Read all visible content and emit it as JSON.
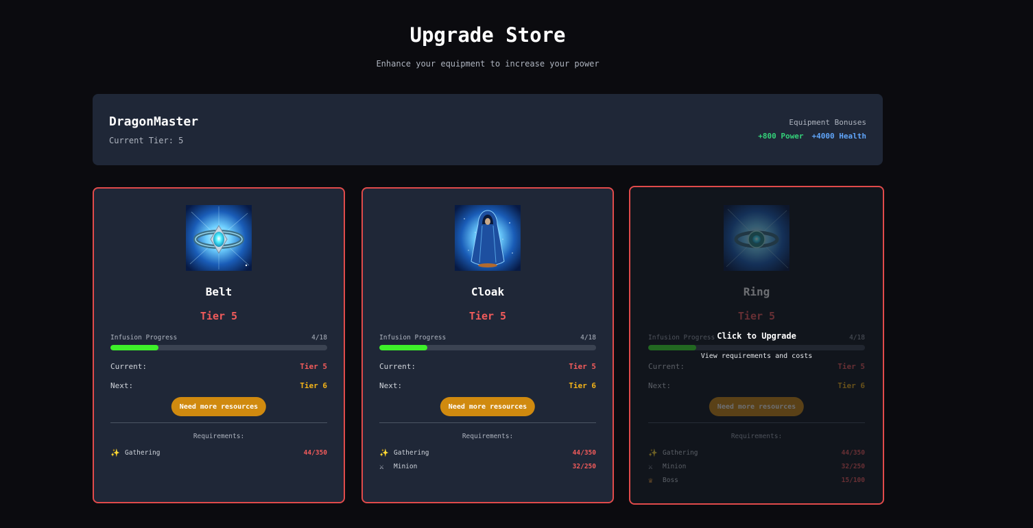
{
  "header": {
    "title": "Upgrade Store",
    "subtitle": "Enhance your equipment to increase your power"
  },
  "player": {
    "name": "DragonMaster",
    "tier_text": "Current Tier: 5",
    "bonuses_title": "Equipment Bonuses",
    "power_bonus": "+800 Power",
    "health_bonus": "+4000 Health"
  },
  "colors": {
    "background": "#0b0b0f",
    "panel": "#1f2737",
    "card_border": "#e24b4b",
    "tier_red": "#f25b5b",
    "next_tier_yellow": "#f5b418",
    "progress_green": "#3ef02a",
    "button_amber": "#d08a0f",
    "power_green": "#34d27a",
    "health_blue": "#60a5fa"
  },
  "cards": [
    {
      "name": "Belt",
      "icon": "belt-item-image",
      "tier": "Tier 5",
      "progress_label": "Infusion Progress",
      "progress_count": "4/18",
      "progress_fraction": 0.222,
      "current_label": "Current:",
      "current_value": "Tier 5",
      "next_label": "Next:",
      "next_value": "Tier 6",
      "button_label": "Need more resources",
      "requirements_title": "Requirements:",
      "requirements": [
        {
          "icon": "sparkles-icon",
          "glyph": "✨",
          "name": "Gathering",
          "value": "44/350"
        }
      ]
    },
    {
      "name": "Cloak",
      "icon": "cloak-item-image",
      "tier": "Tier 5",
      "progress_label": "Infusion Progress",
      "progress_count": "4/18",
      "progress_fraction": 0.222,
      "current_label": "Current:",
      "current_value": "Tier 5",
      "next_label": "Next:",
      "next_value": "Tier 6",
      "button_label": "Need more resources",
      "requirements_title": "Requirements:",
      "requirements": [
        {
          "icon": "sparkles-icon",
          "glyph": "✨",
          "name": "Gathering",
          "value": "44/350"
        },
        {
          "icon": "crossed-swords-icon",
          "glyph": "⚔",
          "name": "Minion",
          "value": "32/250"
        }
      ]
    },
    {
      "name": "Ring",
      "icon": "ring-item-image",
      "tier": "Tier 5",
      "progress_label": "Infusion Progress",
      "progress_count": "4/18",
      "progress_fraction": 0.222,
      "current_label": "Current:",
      "current_value": "Tier 5",
      "next_label": "Next:",
      "next_value": "Tier 6",
      "button_label": "Need more resources",
      "requirements_title": "Requirements:",
      "requirements": [
        {
          "icon": "sparkles-icon",
          "glyph": "✨",
          "name": "Gathering",
          "value": "44/350"
        },
        {
          "icon": "crossed-swords-icon",
          "glyph": "⚔",
          "name": "Minion",
          "value": "32/250"
        },
        {
          "icon": "crown-icon",
          "glyph": "♛",
          "name": "Boss",
          "value": "15/100"
        }
      ],
      "hover_overlay": {
        "title": "Click to Upgrade",
        "subtitle": "View requirements and costs"
      }
    }
  ]
}
